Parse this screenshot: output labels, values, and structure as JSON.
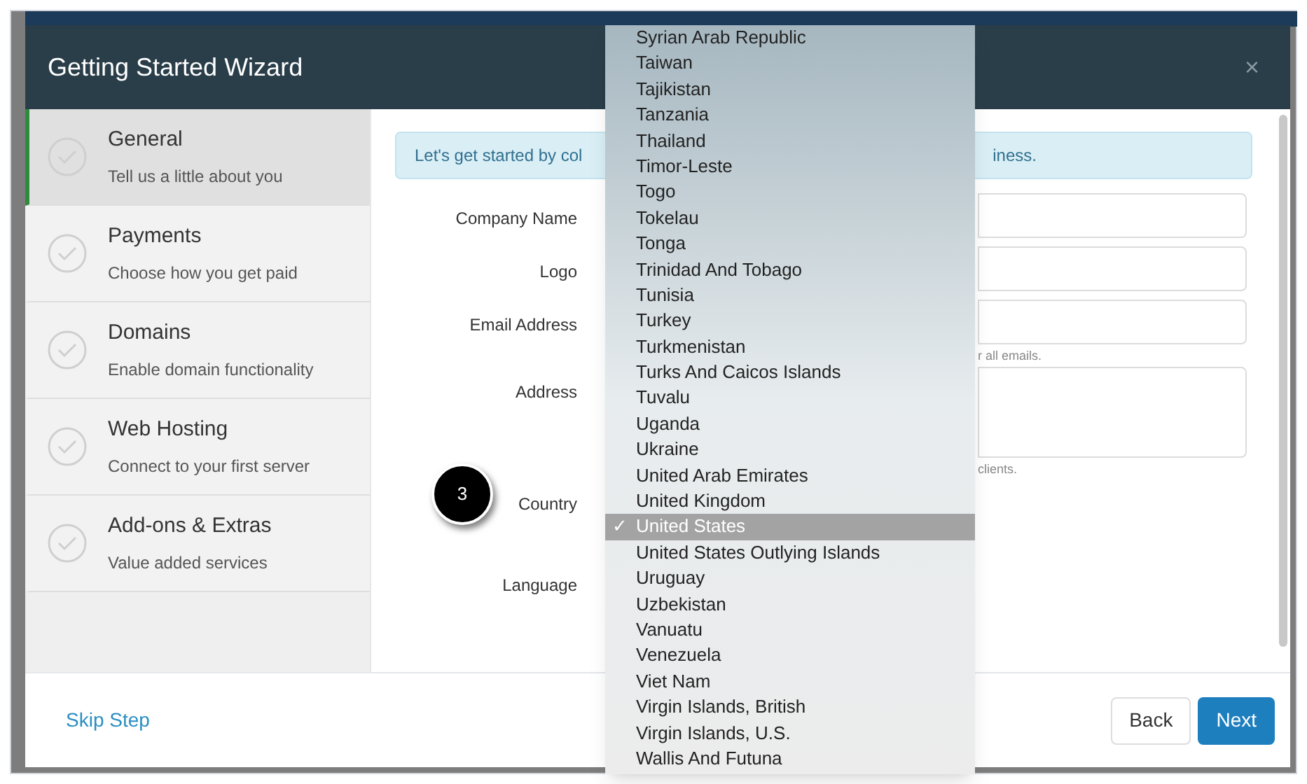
{
  "window": {
    "title": "Getting Started Wizard"
  },
  "steps": [
    {
      "title": "General",
      "subtitle": "Tell us a little about you",
      "selected": true
    },
    {
      "title": "Payments",
      "subtitle": "Choose how you get paid",
      "selected": false
    },
    {
      "title": "Domains",
      "subtitle": "Enable domain functionality",
      "selected": false
    },
    {
      "title": "Web Hosting",
      "subtitle": "Connect to your first server",
      "selected": false
    },
    {
      "title": "Add-ons & Extras",
      "subtitle": "Value added services",
      "selected": false
    }
  ],
  "alert": {
    "text_left": "Let's get started by col",
    "text_right": "iness."
  },
  "form": [
    {
      "label": "Company Name",
      "kind": "input"
    },
    {
      "label": "Logo",
      "kind": "input"
    },
    {
      "label": "Email Address",
      "kind": "input",
      "hint": "r all emails."
    },
    {
      "label": "Address",
      "kind": "textarea",
      "hint": "clients."
    },
    {
      "label": "Country",
      "kind": "select",
      "badge": "3"
    },
    {
      "label": "Language",
      "kind": "select"
    }
  ],
  "dropdown": [
    {
      "label": "Syrian Arab Republic",
      "selected": false
    },
    {
      "label": "Taiwan",
      "selected": false
    },
    {
      "label": "Tajikistan",
      "selected": false
    },
    {
      "label": "Tanzania",
      "selected": false
    },
    {
      "label": "Thailand",
      "selected": false
    },
    {
      "label": "Timor-Leste",
      "selected": false
    },
    {
      "label": "Togo",
      "selected": false
    },
    {
      "label": "Tokelau",
      "selected": false
    },
    {
      "label": "Tonga",
      "selected": false
    },
    {
      "label": "Trinidad And Tobago",
      "selected": false
    },
    {
      "label": "Tunisia",
      "selected": false
    },
    {
      "label": "Turkey",
      "selected": false
    },
    {
      "label": "Turkmenistan",
      "selected": false
    },
    {
      "label": "Turks And Caicos Islands",
      "selected": false
    },
    {
      "label": "Tuvalu",
      "selected": false
    },
    {
      "label": "Uganda",
      "selected": false
    },
    {
      "label": "Ukraine",
      "selected": false
    },
    {
      "label": "United Arab Emirates",
      "selected": false
    },
    {
      "label": "United Kingdom",
      "selected": false
    },
    {
      "label": "United States",
      "selected": true
    },
    {
      "label": "United States Outlying Islands",
      "selected": false
    },
    {
      "label": "Uruguay",
      "selected": false
    },
    {
      "label": "Uzbekistan",
      "selected": false
    },
    {
      "label": "Vanuatu",
      "selected": false
    },
    {
      "label": "Venezuela",
      "selected": false
    },
    {
      "label": "Viet Nam",
      "selected": false
    },
    {
      "label": "Virgin Islands, British",
      "selected": false
    },
    {
      "label": "Virgin Islands, U.S.",
      "selected": false
    },
    {
      "label": "Wallis And Futuna",
      "selected": false
    }
  ],
  "check_mark": "✓",
  "close": "×",
  "footer": {
    "skip": "Skip Step",
    "buttons": [
      {
        "label": "Back",
        "kind": "secondary"
      },
      {
        "label": "Next",
        "kind": "primary"
      }
    ]
  }
}
